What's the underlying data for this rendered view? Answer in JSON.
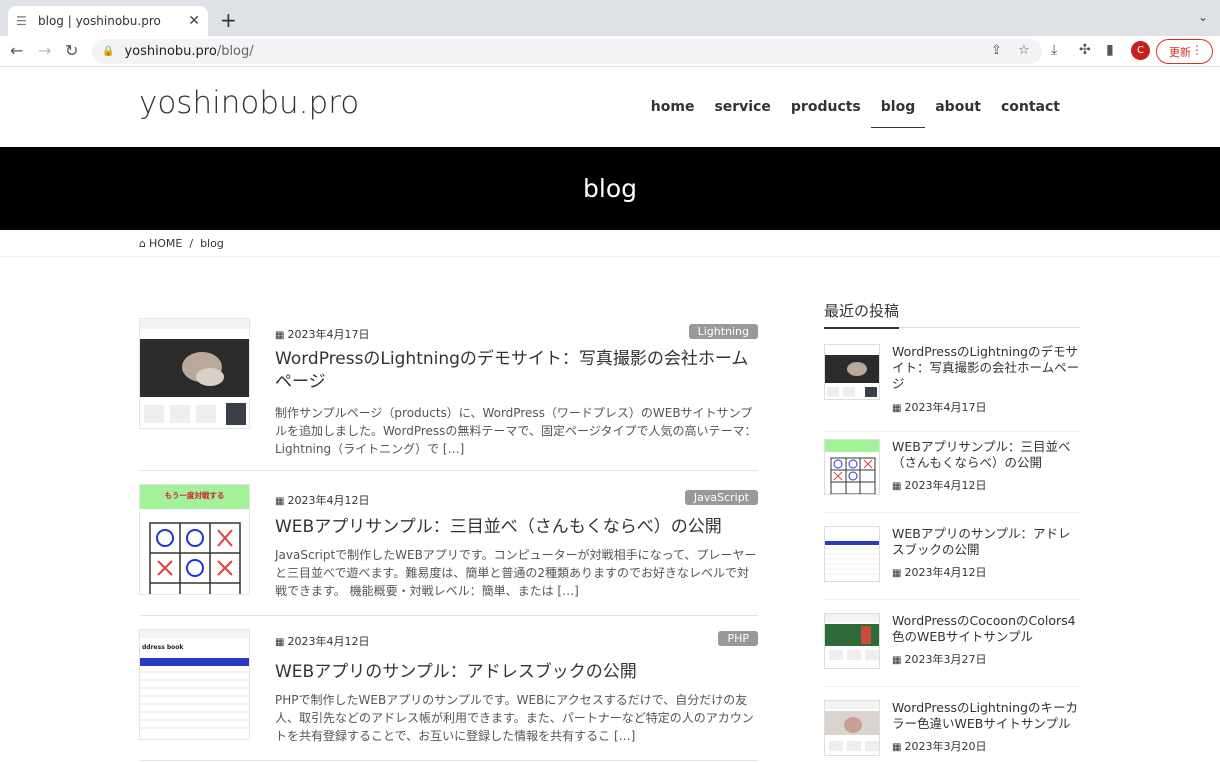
{
  "browser": {
    "tab_title": "blog | yoshinobu.pro",
    "url_host": "yoshinobu.pro",
    "url_path": "/blog/",
    "avatar_letter": "C",
    "update_label": "更新"
  },
  "site": {
    "logo": "yoshinobu.pro",
    "nav": [
      "home",
      "service",
      "products",
      "blog",
      "about",
      "contact"
    ],
    "active_nav": "blog",
    "hero_title": "blog",
    "breadcrumb": {
      "home": "HOME",
      "current": "blog"
    }
  },
  "posts": [
    {
      "date": "2023年4月17日",
      "category": "Lightning",
      "title": "WordPressのLightningのデモサイト：写真撮影の会社ホームページ",
      "excerpt": "制作サンプルページ（products）に、WordPress（ワードプレス）のWEBサイトサンプルを追加しました。WordPressの無料テーマで、固定ページタイプで人気の高いテーマ：Lightning（ライトニング）で […]"
    },
    {
      "date": "2023年4月12日",
      "category": "JavaScript",
      "title": "WEBアプリサンプル：三目並べ（さんもくならべ）の公開",
      "excerpt": "JavaScriptで制作したWEBアプリです。コンピューターが対戦相手になって、プレーヤーと三目並べで遊べます。難易度は、簡単と普通の2種類ありますのでお好きなレベルで対戦できます。 機能概要・対戦レベル：簡単、または […]"
    },
    {
      "date": "2023年4月12日",
      "category": "PHP",
      "title": "WEBアプリのサンプル：アドレスブックの公開",
      "excerpt": "PHPで制作したWEBアプリのサンプルです。WEBにアクセスするだけで、自分だけの友人、取引先などのアドレス帳が利用できます。また、パートナーなど特定の人のアカウントを共有登録することで、お互いに登録した情報を共有するこ […]"
    }
  ],
  "thumb_text": {
    "replay": "もう一度対戦する",
    "address": "ddress book"
  },
  "sidebar": {
    "title": "最近の投稿",
    "items": [
      {
        "title": "WordPressのLightningのデモサイト：写真撮影の会社ホームページ",
        "date": "2023年4月17日"
      },
      {
        "title": "WEBアプリサンプル：三目並べ（さんもくならべ）の公開",
        "date": "2023年4月12日"
      },
      {
        "title": "WEBアプリのサンプル：アドレスブックの公開",
        "date": "2023年4月12日"
      },
      {
        "title": "WordPressのCocoonのColors4色のWEBサイトサンプル",
        "date": "2023年3月27日"
      },
      {
        "title": "WordPressのLightningのキーカラー色違いWEBサイトサンプル",
        "date": "2023年3月20日"
      }
    ]
  }
}
